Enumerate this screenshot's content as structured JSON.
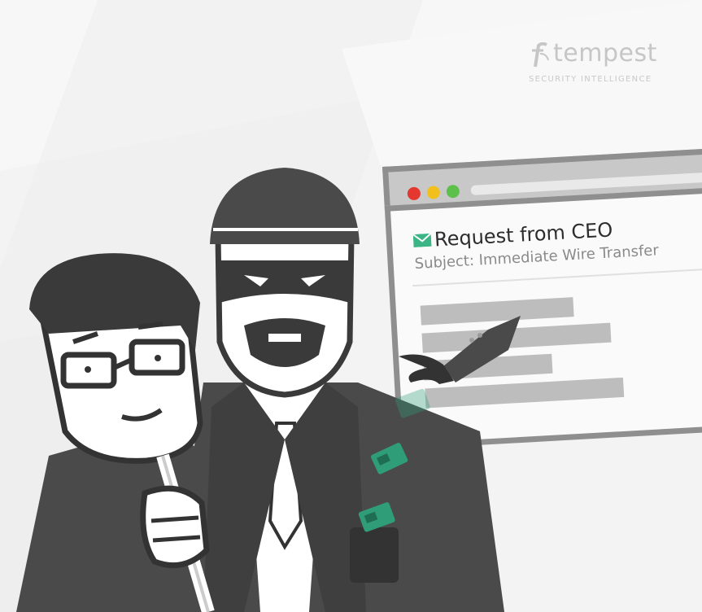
{
  "brand": {
    "name": "tempest",
    "tagline": "SECURITY INTELLIGENCE",
    "color": "#c6c6c6"
  },
  "browser": {
    "window_controls": [
      "close",
      "minimize",
      "maximize"
    ],
    "email": {
      "title": "Request from CEO",
      "subject": "Subject: Immediate Wire Transfer",
      "icon": "envelope-icon",
      "icon_color": "#3bb585"
    }
  },
  "illustration": {
    "figures": [
      "man-with-glasses-mask",
      "masked-thief"
    ],
    "money_color": "#2f9e78",
    "suit_color": "#4a4a4a"
  }
}
